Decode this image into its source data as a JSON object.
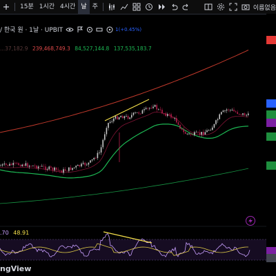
{
  "toolbar": {
    "timeframes": [
      "15분",
      "1시간",
      "4시간",
      "날",
      "주"
    ],
    "active_timeframe": "날",
    "user_label": "이름없음"
  },
  "symbol": {
    "text": "/ 한국 원 · 1날 · UPBIT",
    "change": "1(+0.45%)"
  },
  "ma_values": {
    "v0": "...37,182.9",
    "v1": "239,468,749.3",
    "v2": "84,527,144.8",
    "v3": "137,535,183.7"
  },
  "rsi": {
    "value1": ".70",
    "value2": "48.91"
  },
  "brand": "ngView",
  "colors": {
    "background": "#000000",
    "candle_up": "#c8c8c8",
    "candle_down": "#b81d4c",
    "ma_red": "#c0392b",
    "ma_green": "#1db954",
    "ma_white": "#9aa0a6",
    "divergence": "#f5e04b",
    "rsi_line": "#c9a0ff",
    "rsi_smooth": "#f5e04b",
    "scale_red": "#e53935",
    "scale_blue": "#2962ff",
    "scale_green": "#1e8e3e",
    "scale_purple": "#7b1fa2"
  }
}
